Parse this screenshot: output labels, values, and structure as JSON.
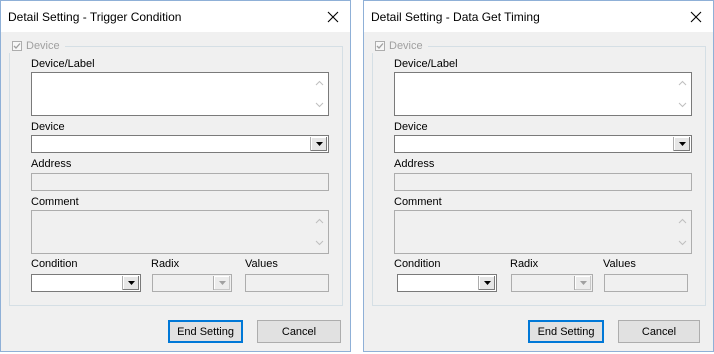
{
  "dialogs": [
    {
      "title": "Detail Setting - Trigger Condition",
      "close_glyph": "✕",
      "group_label": "Device",
      "device_label_caption": "Device/Label",
      "device_caption": "Device",
      "address_caption": "Address",
      "comment_caption": "Comment",
      "condition_caption": "Condition",
      "radix_caption": "Radix",
      "values_caption": "Values",
      "end_setting_label": "End Setting",
      "cancel_label": "Cancel"
    },
    {
      "title": "Detail Setting - Data Get Timing",
      "close_glyph": "✕",
      "group_label": "Device",
      "device_label_caption": "Device/Label",
      "device_caption": "Device",
      "address_caption": "Address",
      "comment_caption": "Comment",
      "condition_caption": "Condition",
      "radix_caption": "Radix",
      "values_caption": "Values",
      "end_setting_label": "End Setting",
      "cancel_label": "Cancel"
    }
  ],
  "colors": {
    "window_border": "#8fb0d7",
    "dialog_face": "#f0f0f0",
    "default_button_border": "#0078d7",
    "disabled_text": "#a0a0a0"
  },
  "icons": {
    "close": "close-icon",
    "checkbox": "checkmark-icon",
    "scroll_up": "chevron-up-icon",
    "scroll_down": "chevron-down-icon",
    "dropdown": "dropdown-arrow-icon"
  }
}
